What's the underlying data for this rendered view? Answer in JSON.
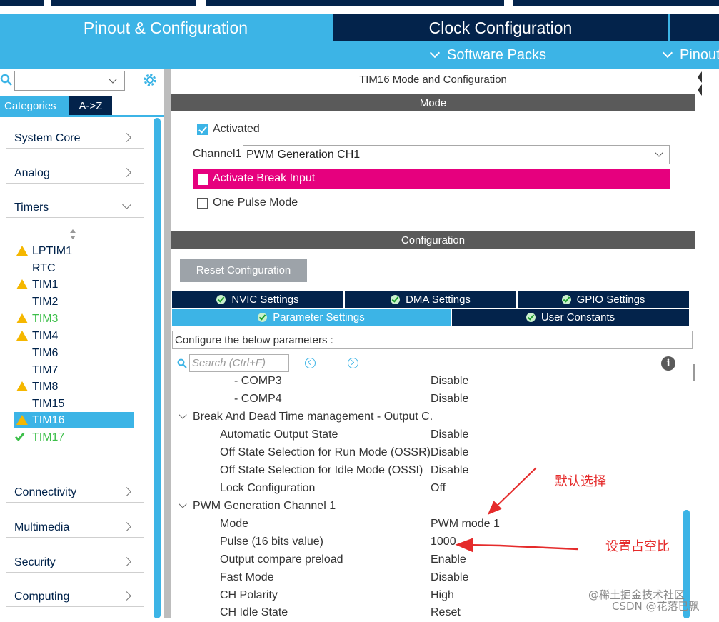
{
  "tabs": {
    "pinout_config": "Pinout & Configuration",
    "clock_config": "Clock Configuration",
    "software_packs": "Software Packs",
    "pinout": "Pinout"
  },
  "left": {
    "tab_categories": "Categories",
    "tab_az": "A->Z",
    "categories": [
      "System Core",
      "Analog",
      "Timers",
      "Connectivity",
      "Multimedia",
      "Security",
      "Computing"
    ],
    "timers": [
      {
        "label": "LPTIM1",
        "status": "warning"
      },
      {
        "label": "RTC",
        "status": "none"
      },
      {
        "label": "TIM1",
        "status": "warning"
      },
      {
        "label": "TIM2",
        "status": "none"
      },
      {
        "label": "TIM3",
        "status": "warning"
      },
      {
        "label": "TIM4",
        "status": "warning"
      },
      {
        "label": "TIM6",
        "status": "none"
      },
      {
        "label": "TIM7",
        "status": "none"
      },
      {
        "label": "TIM8",
        "status": "warning"
      },
      {
        "label": "TIM15",
        "status": "none"
      },
      {
        "label": "TIM16",
        "status": "warning"
      },
      {
        "label": "TIM17",
        "status": "ok"
      }
    ]
  },
  "right": {
    "title": "TIM16 Mode and Configuration",
    "mode_header": "Mode",
    "activated_label": "Activated",
    "channel1_label": "Channel1",
    "channel1_value": "PWM Generation CH1",
    "activate_break_label": "Activate Break Input",
    "one_pulse_label": "One Pulse Mode",
    "config_header": "Configuration",
    "reset_button": "Reset Configuration",
    "tabs": {
      "nvic": "NVIC Settings",
      "dma": "DMA Settings",
      "gpio": "GPIO Settings",
      "parameter": "Parameter Settings",
      "user_constants": "User Constants"
    },
    "configure_text": "Configure the below parameters :",
    "search_placeholder": "Search (Ctrl+F)",
    "info_icon_text": "i",
    "params": [
      {
        "name": "- COMP3",
        "value": "Disable"
      },
      {
        "name": "- COMP4",
        "value": "Disable"
      },
      {
        "name": "Break And Dead Time management - Output C.",
        "value": ""
      },
      {
        "name": "Automatic Output State",
        "value": "Disable"
      },
      {
        "name": "Off State Selection for Run Mode (OSSR)",
        "value": "Disable"
      },
      {
        "name": "Off State Selection for Idle Mode (OSSI)",
        "value": "Disable"
      },
      {
        "name": "Lock Configuration",
        "value": "Off"
      },
      {
        "name": "PWM Generation Channel 1",
        "value": ""
      },
      {
        "name": "Mode",
        "value": "PWM mode 1"
      },
      {
        "name": "Pulse (16 bits value)",
        "value": "1000"
      },
      {
        "name": "Output compare preload",
        "value": "Enable"
      },
      {
        "name": "Fast Mode",
        "value": "Disable"
      },
      {
        "name": "CH Polarity",
        "value": "High"
      },
      {
        "name": "CH Idle State",
        "value": "Reset"
      }
    ]
  },
  "annotations": {
    "default_choice": "默认选择",
    "set_duty": "设置占空比"
  },
  "watermark": {
    "line1": "@稀土掘金技术社区",
    "line2": "CSDN @花落已飘"
  },
  "colors": {
    "accent": "#3cb4e6",
    "navy": "#03234b",
    "break_row": "#e6007e",
    "warning": "#f5b700",
    "ok": "#3dbf4a",
    "annotation": "#e52b2b"
  }
}
